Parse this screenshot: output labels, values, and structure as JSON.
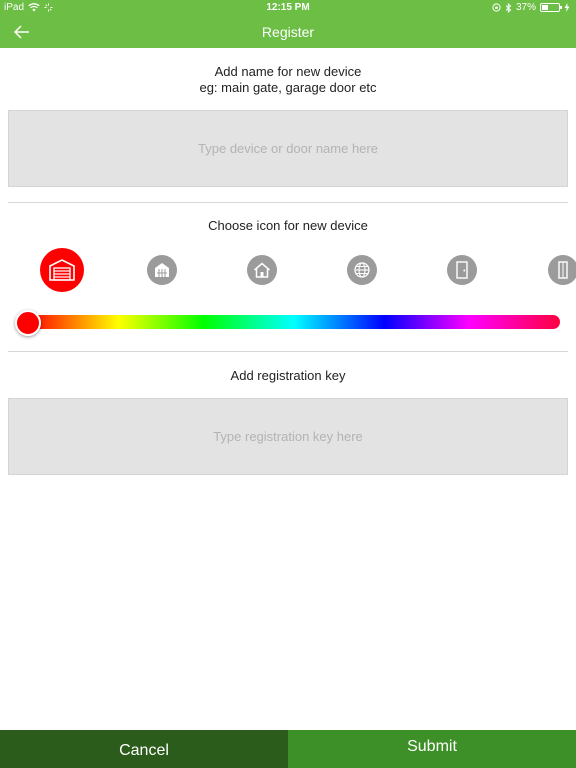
{
  "status_bar": {
    "device": "iPad",
    "time": "12:15 PM",
    "battery": "37%",
    "battery_level": 0.37
  },
  "nav": {
    "title": "Register",
    "back_icon": "arrow-left-icon"
  },
  "device_name": {
    "label_line1": "Add name for new device",
    "label_line2": "eg: main gate, garage door etc",
    "placeholder": "Type device or door name here",
    "value": ""
  },
  "icon_picker": {
    "label": "Choose icon for new device",
    "icons": [
      "garage-door-icon",
      "gate-icon",
      "house-icon",
      "globe-icon",
      "door-icon",
      "partial-door-icon"
    ],
    "selected_index": 0,
    "selected_color": "#ff0000",
    "unselected_color": "#9b9b9b"
  },
  "color_slider": {
    "value": 0
  },
  "registration_key": {
    "label": "Add registration key",
    "placeholder": "Type registration key here",
    "value": ""
  },
  "footer": {
    "cancel_label": "Cancel",
    "submit_label": "Submit"
  },
  "colors": {
    "primary_green": "#6cbe45",
    "cancel_bg": "#2c5c1c",
    "submit_bg": "#3d8f27"
  }
}
